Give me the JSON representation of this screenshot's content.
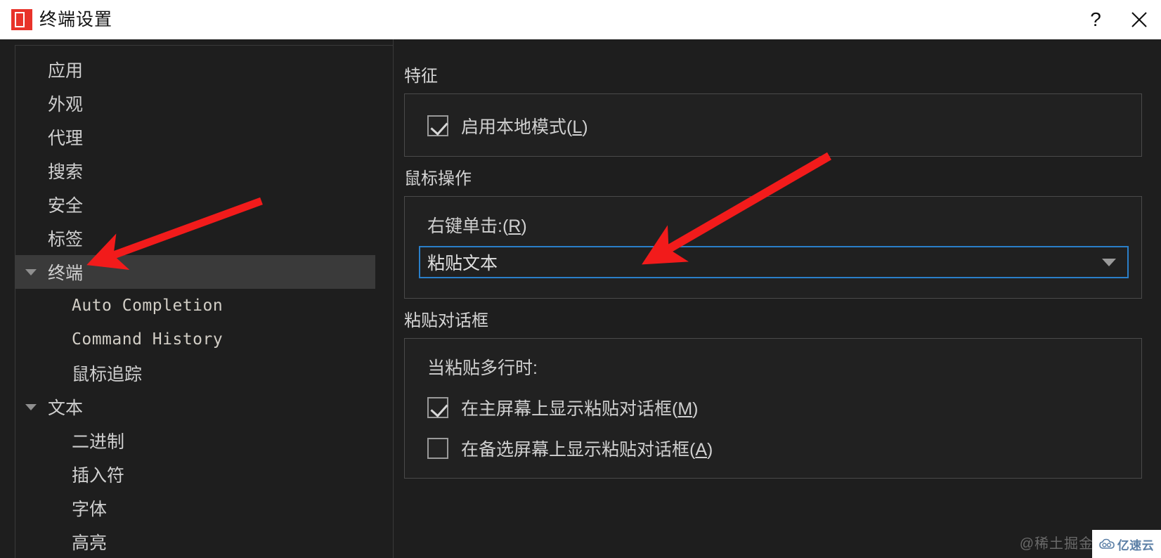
{
  "window": {
    "title": "终端设置",
    "icon": "app-logo-icon",
    "help_label": "?",
    "close_label": "✕",
    "accent_red": "#e8332a",
    "background": "#1e1e1e",
    "focus_blue": "#2a7fc9"
  },
  "sidebar": {
    "items": [
      {
        "label": "应用",
        "level": 0,
        "expandable": false,
        "selected": false,
        "mono": false
      },
      {
        "label": "外观",
        "level": 0,
        "expandable": false,
        "selected": false,
        "mono": false
      },
      {
        "label": "代理",
        "level": 0,
        "expandable": false,
        "selected": false,
        "mono": false
      },
      {
        "label": "搜索",
        "level": 0,
        "expandable": false,
        "selected": false,
        "mono": false
      },
      {
        "label": "安全",
        "level": 0,
        "expandable": false,
        "selected": false,
        "mono": false
      },
      {
        "label": "标签",
        "level": 0,
        "expandable": false,
        "selected": false,
        "mono": false
      },
      {
        "label": "终端",
        "level": 0,
        "expandable": true,
        "selected": true,
        "mono": false
      },
      {
        "label": "Auto Completion",
        "level": 1,
        "expandable": false,
        "selected": false,
        "mono": true
      },
      {
        "label": "Command History",
        "level": 1,
        "expandable": false,
        "selected": false,
        "mono": true
      },
      {
        "label": "鼠标追踪",
        "level": 1,
        "expandable": false,
        "selected": false,
        "mono": false
      },
      {
        "label": "文本",
        "level": 0,
        "expandable": true,
        "selected": false,
        "mono": false
      },
      {
        "label": "二进制",
        "level": 1,
        "expandable": false,
        "selected": false,
        "mono": false
      },
      {
        "label": "插入符",
        "level": 1,
        "expandable": false,
        "selected": false,
        "mono": false
      },
      {
        "label": "字体",
        "level": 1,
        "expandable": false,
        "selected": false,
        "mono": false
      },
      {
        "label": "高亮",
        "level": 1,
        "expandable": false,
        "selected": false,
        "mono": false
      }
    ]
  },
  "main": {
    "features": {
      "title": "特征",
      "local_mode": {
        "label_prefix": "启用本地模式(",
        "mnemonic": "L",
        "label_suffix": ")",
        "checked": true
      }
    },
    "mouse": {
      "title": "鼠标操作",
      "right_click": {
        "label_prefix": "右键单击:(",
        "mnemonic": "R",
        "label_suffix": ")",
        "value": "粘贴文本",
        "focused": true
      }
    },
    "paste_dialog": {
      "title": "粘贴对话框",
      "multiline_label": "当粘贴多行时:",
      "options": [
        {
          "label_prefix": "在主屏幕上显示粘贴对话框(",
          "mnemonic": "M",
          "label_suffix": ")",
          "checked": true
        },
        {
          "label_prefix": "在备选屏幕上显示粘贴对话框(",
          "mnemonic": "A",
          "label_suffix": ")",
          "checked": false
        }
      ]
    }
  },
  "watermarks": {
    "author": "@稀土掘金",
    "brand": "亿速云"
  }
}
